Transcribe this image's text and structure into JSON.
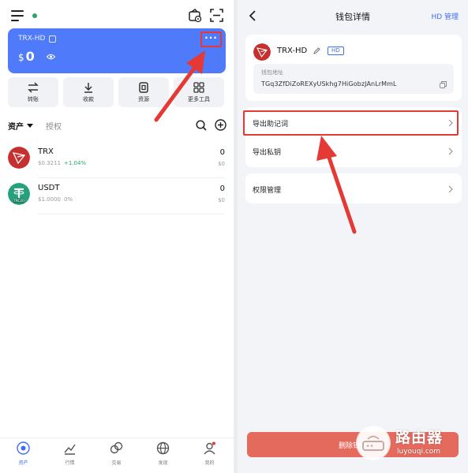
{
  "left": {
    "wallet_card": {
      "name": "TRX-HD",
      "currency": "$",
      "balance": "0",
      "more_glyph": "···"
    },
    "actions": [
      {
        "icon": "transfer-icon",
        "label": "转账"
      },
      {
        "icon": "receive-icon",
        "label": "收款"
      },
      {
        "icon": "resource-icon",
        "label": "资源"
      },
      {
        "icon": "more-tools-icon",
        "label": "更多工具"
      }
    ],
    "asset_tabs": {
      "assets": "资产",
      "authorization": "授权"
    },
    "tokens": [
      {
        "name": "TRX",
        "price": "$0.3211",
        "change": "+1.04%",
        "amount": "0",
        "value": "$0"
      },
      {
        "name": "USDT",
        "price": "$1.0000",
        "change": "0%",
        "amount": "0",
        "value": "$0",
        "logo_label": "TRC20"
      }
    ],
    "bottom_nav": [
      {
        "icon": "assets-nav-icon",
        "label": "资产",
        "active": true
      },
      {
        "icon": "market-nav-icon",
        "label": "行情"
      },
      {
        "icon": "trade-nav-icon",
        "label": "交易"
      },
      {
        "icon": "discover-nav-icon",
        "label": "发现"
      },
      {
        "icon": "profile-nav-icon",
        "label": "我的"
      }
    ]
  },
  "right": {
    "title": "钱包详情",
    "hd_manage": "HD 管理",
    "wallet": {
      "name": "TRX-HD",
      "badge": "HD",
      "address_label": "钱包地址",
      "address": "TGq3ZfDiZoREXyUSkhg7HiGobzJAnLrMmL"
    },
    "menu": {
      "export_mnemonic": "导出助记词",
      "export_private_key": "导出私钥",
      "permission_management": "权限管理"
    },
    "delete_button": "删除钱包"
  },
  "watermark": {
    "title": "路由器",
    "url": "luyouqi.com"
  },
  "colors": {
    "accent_blue": "#3d6ef7",
    "card_blue": "#4f7bfa",
    "annotation_red": "#e53935",
    "positive_green": "#27a567",
    "tron_red": "#c53030",
    "tether_teal": "#26a17b",
    "delete_red": "#e56a5e"
  }
}
